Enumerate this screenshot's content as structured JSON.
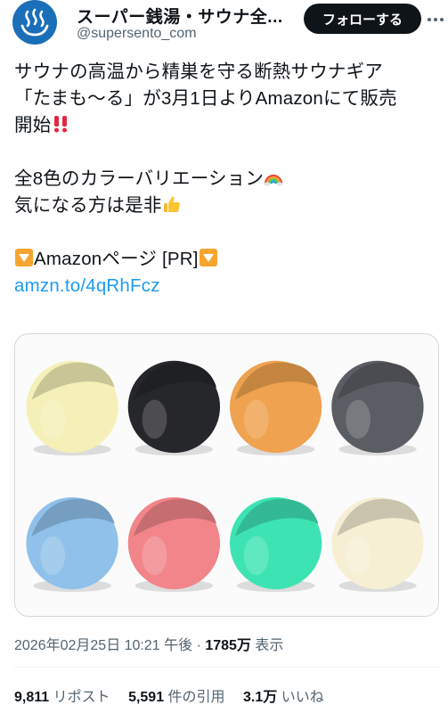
{
  "account": {
    "display_name": "スーパー銭湯・サウナ全...",
    "handle": "@supersento_com",
    "avatar_icon": "hot-spring-icon",
    "avatar_color": "#1a6fb8"
  },
  "follow_button": {
    "label": "フォローする"
  },
  "more_menu": {
    "icon": "more-dots-icon"
  },
  "tweet": {
    "line1": "サウナの高温から精巣を守る断熱サウナギア",
    "line2": "「たまも〜る」が3月1日よりAmazonにて販売",
    "line3": "開始",
    "line3_emoji": "double-exclamation-icon",
    "line4": "全8色のカラーバリエーション",
    "line4_emoji": "rainbow-icon",
    "line5": "気になる方は是非",
    "line5_emoji": "thumbs-up-icon",
    "line6": "Amazonページ [PR]",
    "line6_emoji": "down-triangle-icon",
    "link": "amzn.to/4qRhFcz"
  },
  "media": {
    "cup_colors": [
      "#f5f0b8",
      "#26272b",
      "#efa24f",
      "#5a5d63",
      "#8fc1ea",
      "#f2858a",
      "#3ee3b4",
      "#f6efd4"
    ]
  },
  "meta": {
    "timestamp": "2026年02月25日 10:21 午後 · ",
    "views_count": "1785万",
    "views_label": " 表示"
  },
  "stats": {
    "reposts_count": "9,811",
    "reposts_label": " リポスト",
    "quotes_count": "5,591",
    "quotes_label": " 件の引用",
    "likes_count": "3.1万",
    "likes_label": " いいね"
  }
}
